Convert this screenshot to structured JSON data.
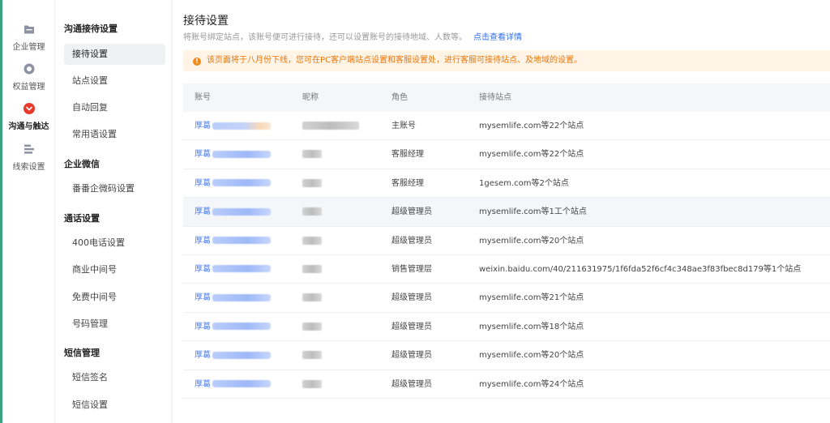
{
  "nav": {
    "items": [
      {
        "label": "企业管理",
        "icon": "folder-icon"
      },
      {
        "label": "权益管理",
        "icon": "circle-icon"
      },
      {
        "label": "沟通与触达",
        "icon": "chat-bubble-icon"
      },
      {
        "label": "线索设置",
        "icon": "list-icon"
      }
    ]
  },
  "submenu": {
    "groups": [
      {
        "title": "沟通接待设置",
        "items": [
          "接待设置",
          "站点设置",
          "自动回复",
          "常用语设置"
        ]
      },
      {
        "title": "企业微信",
        "items": [
          "番番企微码设置"
        ]
      },
      {
        "title": "通话设置",
        "items": [
          "400电话设置",
          "商业中间号",
          "免费中间号",
          "号码管理"
        ]
      },
      {
        "title": "短信管理",
        "items": [
          "短信签名",
          "短信设置"
        ]
      }
    ]
  },
  "page": {
    "title": "接待设置",
    "description": "将账号绑定站点，该账号便可进行接待，还可以设置账号的接待地域、人数等。",
    "details_link": "点击查看详情",
    "notice_icon": "!",
    "notice": "该页面将于八月份下线，您可在PC客户端站点设置和客服设置处，进行客服可接待站点、及地域的设置。"
  },
  "table": {
    "headers": {
      "account": "账号",
      "nickname": "昵称",
      "role": "角色",
      "sites": "接待站点"
    },
    "rows": [
      {
        "account_prefix": "厚葛",
        "role": "主账号",
        "sites": "mysemlife.com等22个站点"
      },
      {
        "account_prefix": "厚葛",
        "role": "客服经理",
        "sites": "mysemlife.com等22个站点"
      },
      {
        "account_prefix": "厚葛",
        "role": "客服经理",
        "sites": "1gesem.com等2个站点"
      },
      {
        "account_prefix": "厚葛",
        "role": "超级管理员",
        "sites": "mysemlife.com等1工个站点"
      },
      {
        "account_prefix": "厚葛",
        "role": "超级管理员",
        "sites": "mysemlife.com等20个站点"
      },
      {
        "account_prefix": "厚葛",
        "role": "销售管理层",
        "sites": "weixin.baidu.com/40/211631975/1f6fda52f6cf4c348ae3f83fbec8d179等1个站点"
      },
      {
        "account_prefix": "厚葛",
        "role": "超级管理员",
        "sites": "mysemlife.com等21个站点"
      },
      {
        "account_prefix": "厚葛",
        "role": "超级管理员",
        "sites": "mysemlife.com等18个站点"
      },
      {
        "account_prefix": "厚葛",
        "role": "超级管理员",
        "sites": "mysemlife.com等20个站点"
      },
      {
        "account_prefix": "厚葛",
        "role": "超级管理员",
        "sites": "mysemlife.com等24个站点"
      }
    ]
  },
  "colors": {
    "accent": "#2f6fe8",
    "active_nav_icon": "#e8392b",
    "notice_bg": "#fff4e5",
    "notice_text": "#e8760a"
  }
}
